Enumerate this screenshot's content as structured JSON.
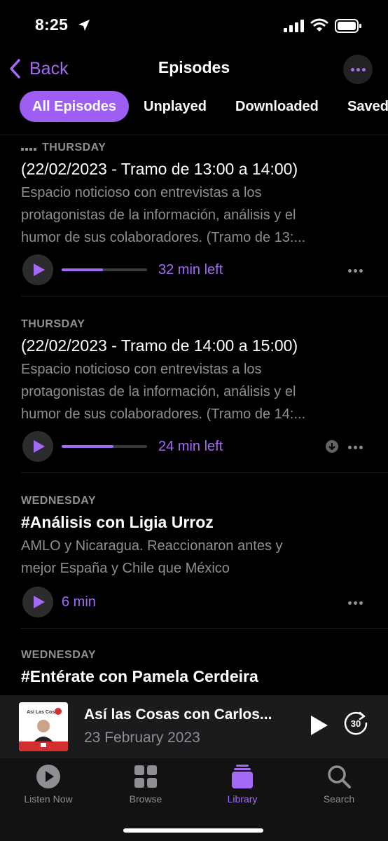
{
  "status": {
    "time": "8:25"
  },
  "nav": {
    "back_label": "Back",
    "title": "Episodes"
  },
  "filters": [
    "All Episodes",
    "Unplayed",
    "Downloaded",
    "Saved"
  ],
  "episodes": [
    {
      "day": "THURSDAY",
      "title": "(22/02/2023 - Tramo de 13:00 a 14:00)",
      "description": [
        "Espacio noticioso con entrevistas a los",
        "protagonistas de la información, análisis y el",
        "humor de sus colaboradores. (Tramo de 13:..."
      ],
      "time": "32 min left",
      "progress": 0.48,
      "downloaded": false,
      "in_progress_indicator": true
    },
    {
      "day": "THURSDAY",
      "title": "(22/02/2023 - Tramo de 14:00 a 15:00)",
      "description": [
        "Espacio noticioso con entrevistas a los",
        "protagonistas de la información, análisis y el",
        "humor de sus colaboradores. (Tramo de 14:..."
      ],
      "time": "24 min left",
      "progress": 0.61,
      "downloaded": true
    },
    {
      "day": "WEDNESDAY",
      "title": "#Análisis con Ligia Urroz",
      "description": [
        "AMLO y Nicaragua. Reaccionaron antes y",
        "mejor España y Chile que México"
      ],
      "time": "6 min"
    },
    {
      "day": "WEDNESDAY",
      "title": "#Entérate con Pamela Cerdeira"
    }
  ],
  "now_playing": {
    "title": "Así las Cosas con Carlos...",
    "subtitle": "23 February 2023",
    "skip_seconds": "30",
    "artwork_text": "Así Las Cosas"
  },
  "tabs": [
    {
      "label": "Listen Now",
      "icon": "play-circle-icon"
    },
    {
      "label": "Browse",
      "icon": "grid-icon"
    },
    {
      "label": "Library",
      "icon": "library-stack-icon"
    },
    {
      "label": "Search",
      "icon": "magnifier-icon"
    }
  ],
  "colors": {
    "accent": "#a36af6",
    "background": "#000000",
    "secondary_text": "#8e8e93"
  }
}
